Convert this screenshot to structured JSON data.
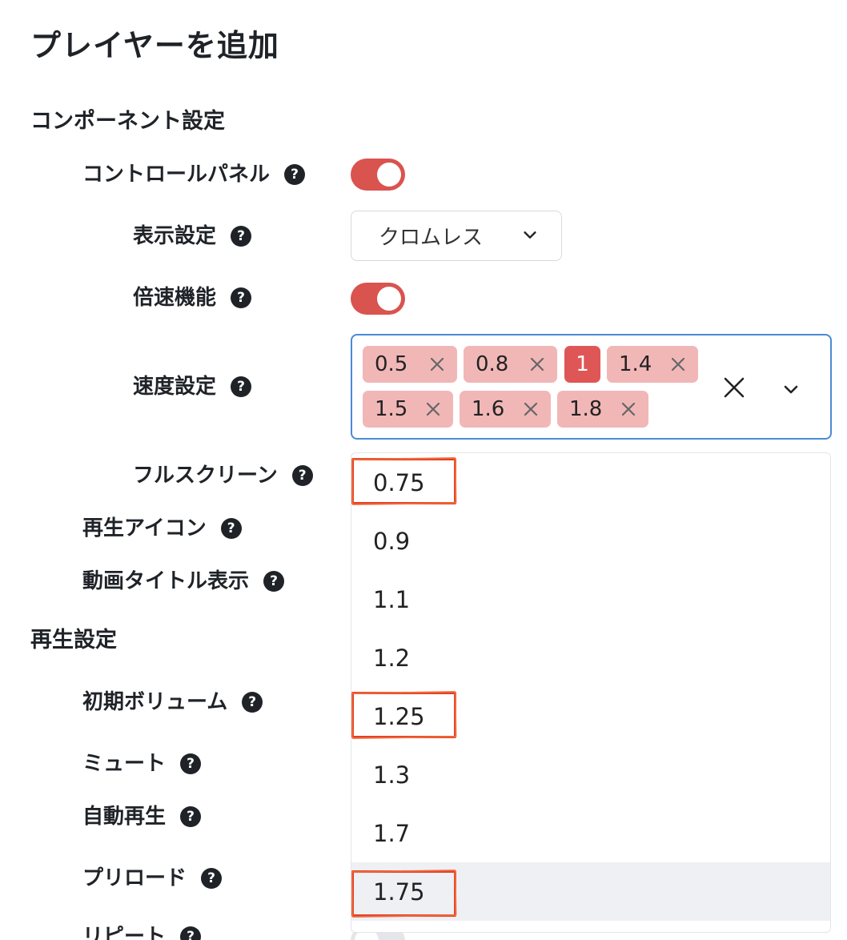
{
  "page": {
    "title": "プレイヤーを追加"
  },
  "component_settings": {
    "heading": "コンポーネント設定",
    "control_panel": {
      "label": "コントロールパネル",
      "enabled": true
    },
    "display_setting": {
      "label": "表示設定",
      "value": "クロムレス"
    },
    "speed_function": {
      "label": "倍速機能",
      "enabled": true
    },
    "speed_setting": {
      "label": "速度設定",
      "selected_chips": [
        "0.5",
        "0.8",
        "1",
        "1.4",
        "1.5",
        "1.6",
        "1.8"
      ],
      "active_chip": "1"
    },
    "fullscreen": {
      "label": "フルスクリーン"
    },
    "play_icon": {
      "label": "再生アイコン"
    },
    "video_title": {
      "label": "動画タイトル表示"
    }
  },
  "playback_settings": {
    "heading": "再生設定",
    "initial_volume": {
      "label": "初期ボリューム"
    },
    "mute": {
      "label": "ミュート"
    },
    "autoplay": {
      "label": "自動再生"
    },
    "preload": {
      "label": "プリロード"
    },
    "repeat": {
      "label": "リピート"
    }
  },
  "speed_dropdown": {
    "options": [
      "0.75",
      "0.9",
      "1.1",
      "1.2",
      "1.25",
      "1.3",
      "1.7",
      "1.75"
    ],
    "hovered": "1.75",
    "highlighted": [
      "0.75",
      "1.25",
      "1.75"
    ]
  },
  "help_glyph": "?",
  "colors": {
    "toggle_on": "#d9534f",
    "chip": "#f1b7b7",
    "chip_active": "#df5656",
    "focus_border": "#4a8ad6",
    "annotation": "#e5391f"
  }
}
